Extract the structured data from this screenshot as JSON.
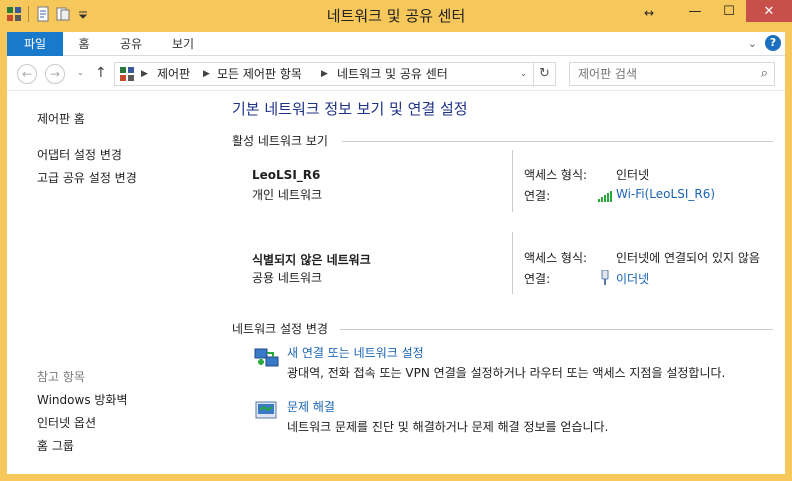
{
  "window": {
    "title": "네트워크 및 공유 센터",
    "controls": {
      "minimize": "—",
      "maximize": "☐",
      "close": "✕",
      "resize": "↔"
    }
  },
  "ribbon": {
    "tabs": [
      {
        "label": "파일"
      },
      {
        "label": "홈"
      },
      {
        "label": "공유"
      },
      {
        "label": "보기"
      }
    ],
    "help": "?",
    "expand": "⌄"
  },
  "navigation": {
    "back": "←",
    "forward": "→",
    "dropdown": "⌄",
    "up": "↑",
    "breadcrumb": [
      {
        "label": "제어판"
      },
      {
        "label": "모든 제어판 항목"
      },
      {
        "label": "네트워크 및 공유 센터"
      }
    ],
    "separator": "▶",
    "refresh": "↻",
    "search": {
      "placeholder": "제어판 검색",
      "icon": "search-icon"
    }
  },
  "sidebar": {
    "home": "제어판 홈",
    "links": [
      {
        "label": "어댑터 설정 변경"
      },
      {
        "label": "고급 공유 설정 변경"
      }
    ],
    "see_also": {
      "heading": "참고 항목",
      "items": [
        {
          "label": "Windows 방화벽"
        },
        {
          "label": "인터넷 옵션"
        },
        {
          "label": "홈 그룹"
        }
      ]
    }
  },
  "main": {
    "heading": "기본 네트워크 정보 보기 및 연결 설정",
    "active_section": "활성 네트워크 보기",
    "networks": [
      {
        "name": "LeoLSI_R6",
        "type": "개인 네트워크",
        "access_label": "액세스 형식:",
        "access_value": "인터넷",
        "conn_label": "연결:",
        "conn_value": "Wi-Fi(LeoLSI_R6)",
        "conn_icon": "wifi-signal-icon"
      },
      {
        "name": "식별되지 않은 네트워크",
        "type": "공용 네트워크",
        "access_label": "액세스 형식:",
        "access_value": "인터넷에 연결되어 있지 않음",
        "conn_label": "연결:",
        "conn_value": "이더넷",
        "conn_icon": "ethernet-plug-icon"
      }
    ],
    "settings_section": "네트워크 설정 변경",
    "tasks": [
      {
        "title": "새 연결 또는 네트워크 설정",
        "description": "광대역, 전화 접속 또는 VPN 연결을 설정하거나 라우터 또는 액세스 지점을 설정합니다.",
        "icon": "new-connection-icon"
      },
      {
        "title": "문제 해결",
        "description": "네트워크 문제를 진단 및 해결하거나 문제 해결 정보를 얻습니다.",
        "icon": "troubleshoot-icon"
      }
    ]
  },
  "colors": {
    "frame": "#f6c75a",
    "file_tab": "#1979ca",
    "link": "#1a64b4",
    "heading": "#1e3287",
    "close": "#c7504a"
  }
}
